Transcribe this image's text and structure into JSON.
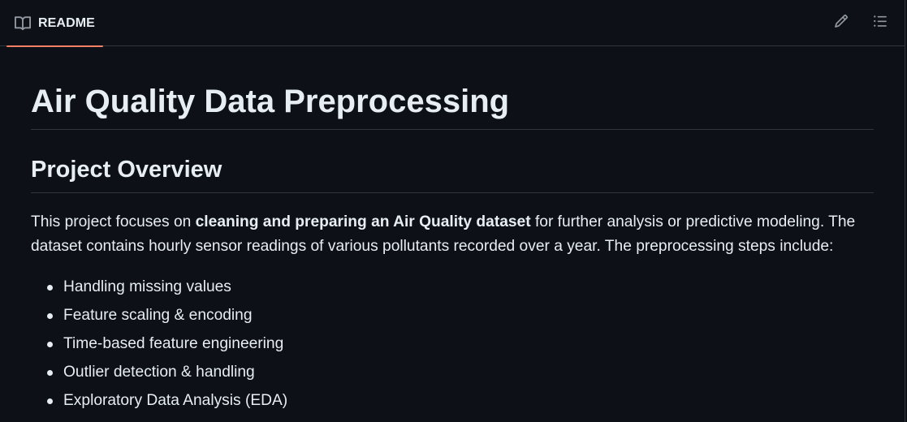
{
  "tabbar": {
    "tab_label": "README"
  },
  "article": {
    "title": "Air Quality Data Preprocessing",
    "section_heading": "Project Overview",
    "overview": {
      "intro": "This project focuses on ",
      "emphasis": "cleaning and preparing an Air Quality dataset",
      "rest": " for further analysis or predictive modeling. The dataset contains hourly sensor readings of various pollutants recorded over a year. The preprocessing steps include:"
    },
    "steps": [
      "Handling missing values",
      "Feature scaling & encoding",
      "Time-based feature engineering",
      "Outlier detection & handling",
      "Exploratory Data Analysis (EDA)"
    ]
  },
  "icons": {
    "tab": "book-icon",
    "edit": "pencil-icon",
    "outline": "list-unordered-icon"
  },
  "colors": {
    "background": "#0d1117",
    "text": "#e6edf3",
    "muted_icon": "#9198a1",
    "border": "#30363d",
    "active_tab_underline": "#f78166"
  }
}
